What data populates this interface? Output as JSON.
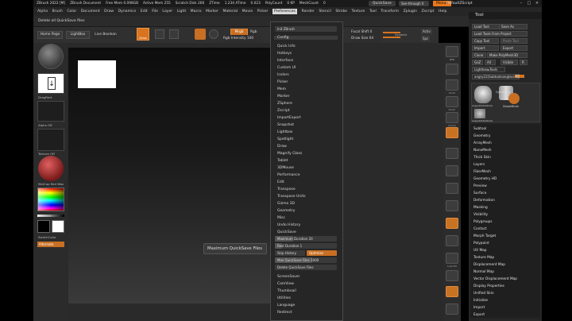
{
  "titlebar": {
    "app": "ZBrush 2022 [M]",
    "document": "ZBrush Document",
    "free_mem": "Free Mem 0.098GB",
    "active_mem": "Active Mem 255",
    "scratch_disk": "Scratch Disk 266",
    "ztime": "ZTime",
    "atime": "1.234 ATime",
    "atime_val": "0.023",
    "poly_count": "PolyCount",
    "poly_val": "0 KP",
    "mesh_count": "MeshCount",
    "mesh_val": "0",
    "quicksave": "QuickSave",
    "see_through": "See-through 0",
    "menus": "Menus",
    "default_script": "DefaultZScript"
  },
  "menubar": [
    "Alpha",
    "Brush",
    "Color",
    "Document",
    "Draw",
    "Dynamics",
    "Edit",
    "File",
    "Layer",
    "Light",
    "Macro",
    "Marker",
    "Material",
    "Movie",
    "Picker",
    "Preferences",
    "Render",
    "Stencil",
    "Stroke",
    "Texture",
    "Tool",
    "Transform",
    "Zplugin",
    "Zscript",
    "Help"
  ],
  "notify": "Delete all QuickSave files",
  "toolbar": {
    "home_page": "Home Page",
    "lightbox": "LightBox",
    "live_boolean": "Live Boolean",
    "draw": "Draw",
    "mrgb": "Mrgb",
    "rgb_intensity": "Rgb Intensity 100",
    "rgb": "Rgb",
    "focal_shift": "Focal Shift 0",
    "draw_size": "Draw Size 64",
    "dynamic": "Dynamic"
  },
  "leftshelf": {
    "stroke": "DragRect",
    "alpha": "Alpha Off",
    "texture": "Texture Off",
    "material": "MatCap Red Wax",
    "gradient": "Gradient",
    "switch_color": "SwitchColor",
    "alternate": "Alternate"
  },
  "tooltip": "Maximum QuickSave Files",
  "preferences_menu": {
    "search": "Init ZBrush",
    "items": [
      "Config",
      "Quick Info",
      "Hotkeys",
      "Interface",
      "Custom UI",
      "Icolors",
      "Picker",
      "Mem",
      "Marker",
      "ZSphere",
      "Zscript",
      "ImportExport",
      "Snapshot",
      "Lightbox",
      "Spotlight",
      "Draw",
      "Magnify Glass",
      "Tablet",
      "3DMouse",
      "Performance",
      "Edit",
      "Transpose",
      "Transpose Units",
      "Gizmo 3D",
      "Geometry",
      "Misc",
      "Undo History",
      "QuickSave"
    ],
    "quicksave": {
      "maximum_duration": "Maximum Duration 20",
      "rest_duration": "Rest Duration 1",
      "skip_history": "Skip History",
      "optimize": "Optimize",
      "max_files": "Max QuickSave Files 1000",
      "delete_files": "Delete QuickSave Files"
    },
    "items_after": [
      "ScreenSaver",
      "CamView",
      "Thumbnail",
      "Utilities",
      "Language",
      "Redirect"
    ]
  },
  "tool_palette": {
    "title": "Tool",
    "load_tool": "Load Tool",
    "save_as": "Save As",
    "load_from_project": "Load Tools From Project",
    "copy_tool": "Copy Tool",
    "paste_tool": "Paste Tool",
    "import": "Import",
    "export": "Export",
    "clone": "Clone",
    "make_polymesh": "Make PolyMesh3D",
    "goz": "GoZ",
    "all": "All",
    "visible": "Visible",
    "r": "R",
    "lightbox_tools": "Lightbox▸Tools",
    "current_tool": "angry22(Subtoolsonglasses)",
    "current_num": "48",
    "thumb1": "angry22(Subtool)",
    "thumb2": "Cylinder3D",
    "thumb3": "SimpleBrush",
    "thumb4": "angry22(Subtool)",
    "items": [
      "Subtool",
      "Geometry",
      "ArrayMesh",
      "NanoMesh",
      "Thick Skin",
      "Layers",
      "FiberMesh",
      "Geometry HD",
      "Preview",
      "Surface",
      "Deformation",
      "Masking",
      "Visibility",
      "Polygroups",
      "Contact",
      "Morph Target",
      "Polypaint",
      "UV Map",
      "Texture Map",
      "Displacement Map",
      "Normal Map",
      "Vector Displacement Map",
      "Display Properties",
      "Unified Skin",
      "Initialize",
      "Import",
      "Export"
    ]
  },
  "rightshelf": [
    "BPR",
    "SPix",
    "Scroll",
    "Zoom",
    "Actual",
    "AAHalf",
    "Persp",
    "Floor",
    "Local",
    "L.Sym",
    "Gxyz",
    "Frame",
    "Move",
    "Scale",
    "Rotate",
    "Line Fill",
    "PolyF",
    "Transp",
    "Solo",
    "Xpose"
  ],
  "colors": {
    "accent": "#e8781b",
    "panel": "#262626"
  }
}
